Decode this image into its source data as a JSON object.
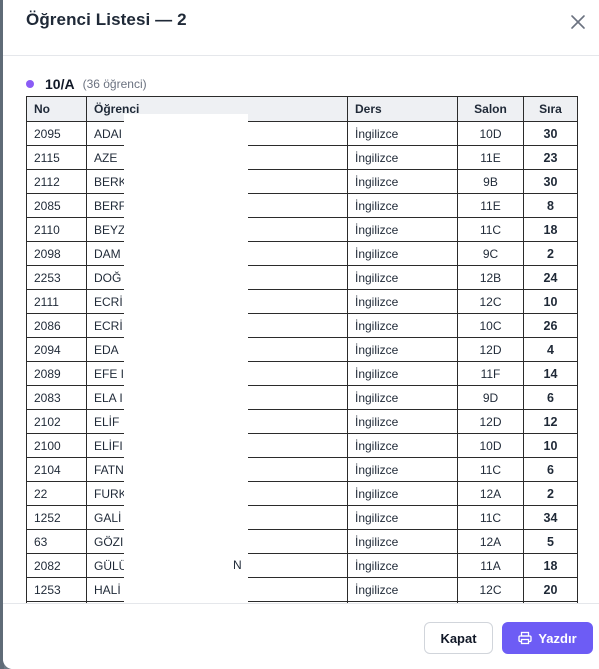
{
  "modal": {
    "title": "Öğrenci Listesi — 2"
  },
  "group": {
    "name": "10/A",
    "count": "(36 öğrenci)",
    "accent": "#8b5cf6"
  },
  "table": {
    "headers": {
      "no": "No",
      "name": "Öğrenci",
      "ders": "Ders",
      "salon": "Salon",
      "sira": "Sıra"
    },
    "rows": [
      {
        "no": "2095",
        "name": "ADAI",
        "ders": "İngilizce",
        "salon": "10D",
        "sira": "30"
      },
      {
        "no": "2115",
        "name": "AZE",
        "ders": "İngilizce",
        "salon": "11E",
        "sira": "23"
      },
      {
        "no": "2112",
        "name": "BERK",
        "ders": "İngilizce",
        "salon": "9B",
        "sira": "30"
      },
      {
        "no": "2085",
        "name": "BERF",
        "ders": "İngilizce",
        "salon": "11E",
        "sira": "8"
      },
      {
        "no": "2110",
        "name": "BEYZ",
        "ders": "İngilizce",
        "salon": "11C",
        "sira": "18"
      },
      {
        "no": "2098",
        "name": "DAM",
        "ders": "İngilizce",
        "salon": "9C",
        "sira": "2"
      },
      {
        "no": "2253",
        "name": "DOĞ",
        "ders": "İngilizce",
        "salon": "12B",
        "sira": "24"
      },
      {
        "no": "2111",
        "name": "ECRİ",
        "ders": "İngilizce",
        "salon": "12C",
        "sira": "10"
      },
      {
        "no": "2086",
        "name": "ECRİ",
        "ders": "İngilizce",
        "salon": "10C",
        "sira": "26"
      },
      {
        "no": "2094",
        "name": "EDA",
        "ders": "İngilizce",
        "salon": "12D",
        "sira": "4"
      },
      {
        "no": "2089",
        "name": "EFE I",
        "ders": "İngilizce",
        "salon": "11F",
        "sira": "14"
      },
      {
        "no": "2083",
        "name": "ELA I",
        "ders": "İngilizce",
        "salon": "9D",
        "sira": "6"
      },
      {
        "no": "2102",
        "name": "ELİF",
        "ders": "İngilizce",
        "salon": "12D",
        "sira": "12"
      },
      {
        "no": "2100",
        "name": "ELİFI",
        "ders": "İngilizce",
        "salon": "10D",
        "sira": "10"
      },
      {
        "no": "2104",
        "name": "FATN",
        "ders": "İngilizce",
        "salon": "11C",
        "sira": "6"
      },
      {
        "no": "22",
        "name": "FURK",
        "ders": "İngilizce",
        "salon": "12A",
        "sira": "2"
      },
      {
        "no": "1252",
        "name": "GALİ",
        "ders": "İngilizce",
        "salon": "11C",
        "sira": "34"
      },
      {
        "no": "63",
        "name": "GÖZI",
        "ders": "İngilizce",
        "salon": "12A",
        "sira": "5"
      },
      {
        "no": "2082",
        "name": "GÜLÜ",
        "name_tail": "N",
        "ders": "İngilizce",
        "salon": "11A",
        "sira": "18"
      },
      {
        "no": "1253",
        "name": "HALİ",
        "ders": "İngilizce",
        "salon": "12C",
        "sira": "20"
      },
      {
        "no": "",
        "name": "",
        "ders": "",
        "salon": "",
        "sira": ""
      }
    ]
  },
  "footer": {
    "close_label": "Kapat",
    "print_label": "Yazdır",
    "print_color": "#6d5cf5"
  }
}
